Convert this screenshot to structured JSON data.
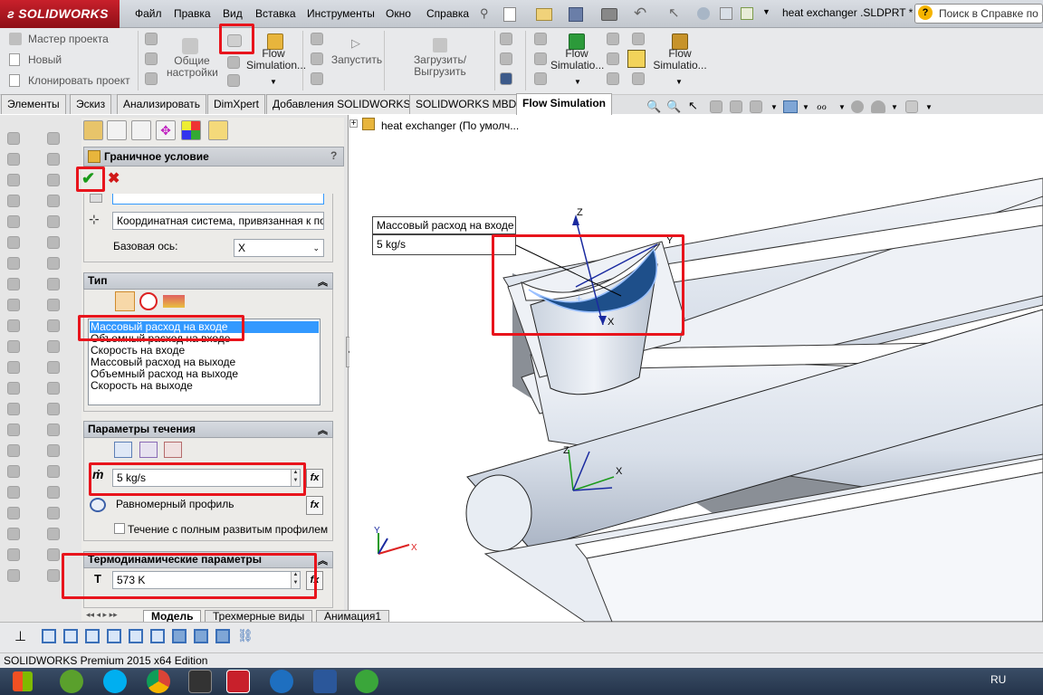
{
  "app": {
    "logo_text": "SOLIDWORKS",
    "menu": [
      "Файл",
      "Правка",
      "Вид",
      "Вставка",
      "Инструменты",
      "Окно",
      "Справка"
    ],
    "document_title": "heat exchanger .SLDPRT *",
    "help_search_placeholder": "Поиск в Справке по SOLIDWORKS"
  },
  "commands": {
    "small": [
      "Мастер проекта",
      "Новый",
      "Клонировать проект"
    ],
    "general_settings": "Общие настройки",
    "flow_sim_1": "Flow Simulation...",
    "run": "Запустить",
    "load_unload": "Загрузить/Выгрузить",
    "flow_sim_2": "Flow Simulatio...",
    "flow_sim_3": "Flow Simulatio..."
  },
  "tabs": [
    {
      "label": "Элементы",
      "active": false
    },
    {
      "label": "Эскиз",
      "active": false
    },
    {
      "label": "Анализировать",
      "active": false
    },
    {
      "label": "DimXpert",
      "active": false
    },
    {
      "label": "Добавления SOLIDWORKS",
      "active": false
    },
    {
      "label": "SOLIDWORKS MBD",
      "active": false
    },
    {
      "label": "Flow Simulation",
      "active": true
    }
  ],
  "panel": {
    "title": "Граничное условие",
    "help": "?",
    "coord_system": "Координатная система, привязанная к повер",
    "base_axis_label": "Базовая ось:",
    "base_axis_value": "X",
    "type_section": "Тип",
    "type_list": [
      "Массовый расход на входе",
      "Объемный расход на входе",
      "Скорость на входе",
      "Массовый расход на выходе",
      "Объемный расход на выходе",
      "Скорость на выходе"
    ],
    "selected_index": 0,
    "flow_section": "Параметры течения",
    "mass_flow_symbol": "ṁ",
    "mass_flow_value": "5 kg/s",
    "profile_value": "Равномерный профиль",
    "fully_developed_label": "Течение с полным развитым профилем",
    "fully_developed_checked": false,
    "thermo_section": "Термодинамические параметры",
    "temp_symbol": "T",
    "temp_value": "573 K",
    "fx": "fx"
  },
  "viewport": {
    "tree_root": "heat exchanger  (По умолч...",
    "callout_title": "Массовый расход на входе",
    "callout_value": "5 kg/s",
    "axis_x": "X",
    "axis_y": "Y",
    "axis_z": "Z"
  },
  "bottom_tabs": [
    {
      "label": "Модель",
      "active": true
    },
    {
      "label": "Трехмерные виды",
      "active": false
    },
    {
      "label": "Анимация1",
      "active": false
    }
  ],
  "status_text": "SOLIDWORKS Premium 2015 x64 Edition",
  "taskbar": {
    "lang": "RU"
  },
  "colors": {
    "highlight_red": "#e8141c",
    "selection_blue": "#3399ff",
    "model_surface": "#dfe6f0"
  }
}
